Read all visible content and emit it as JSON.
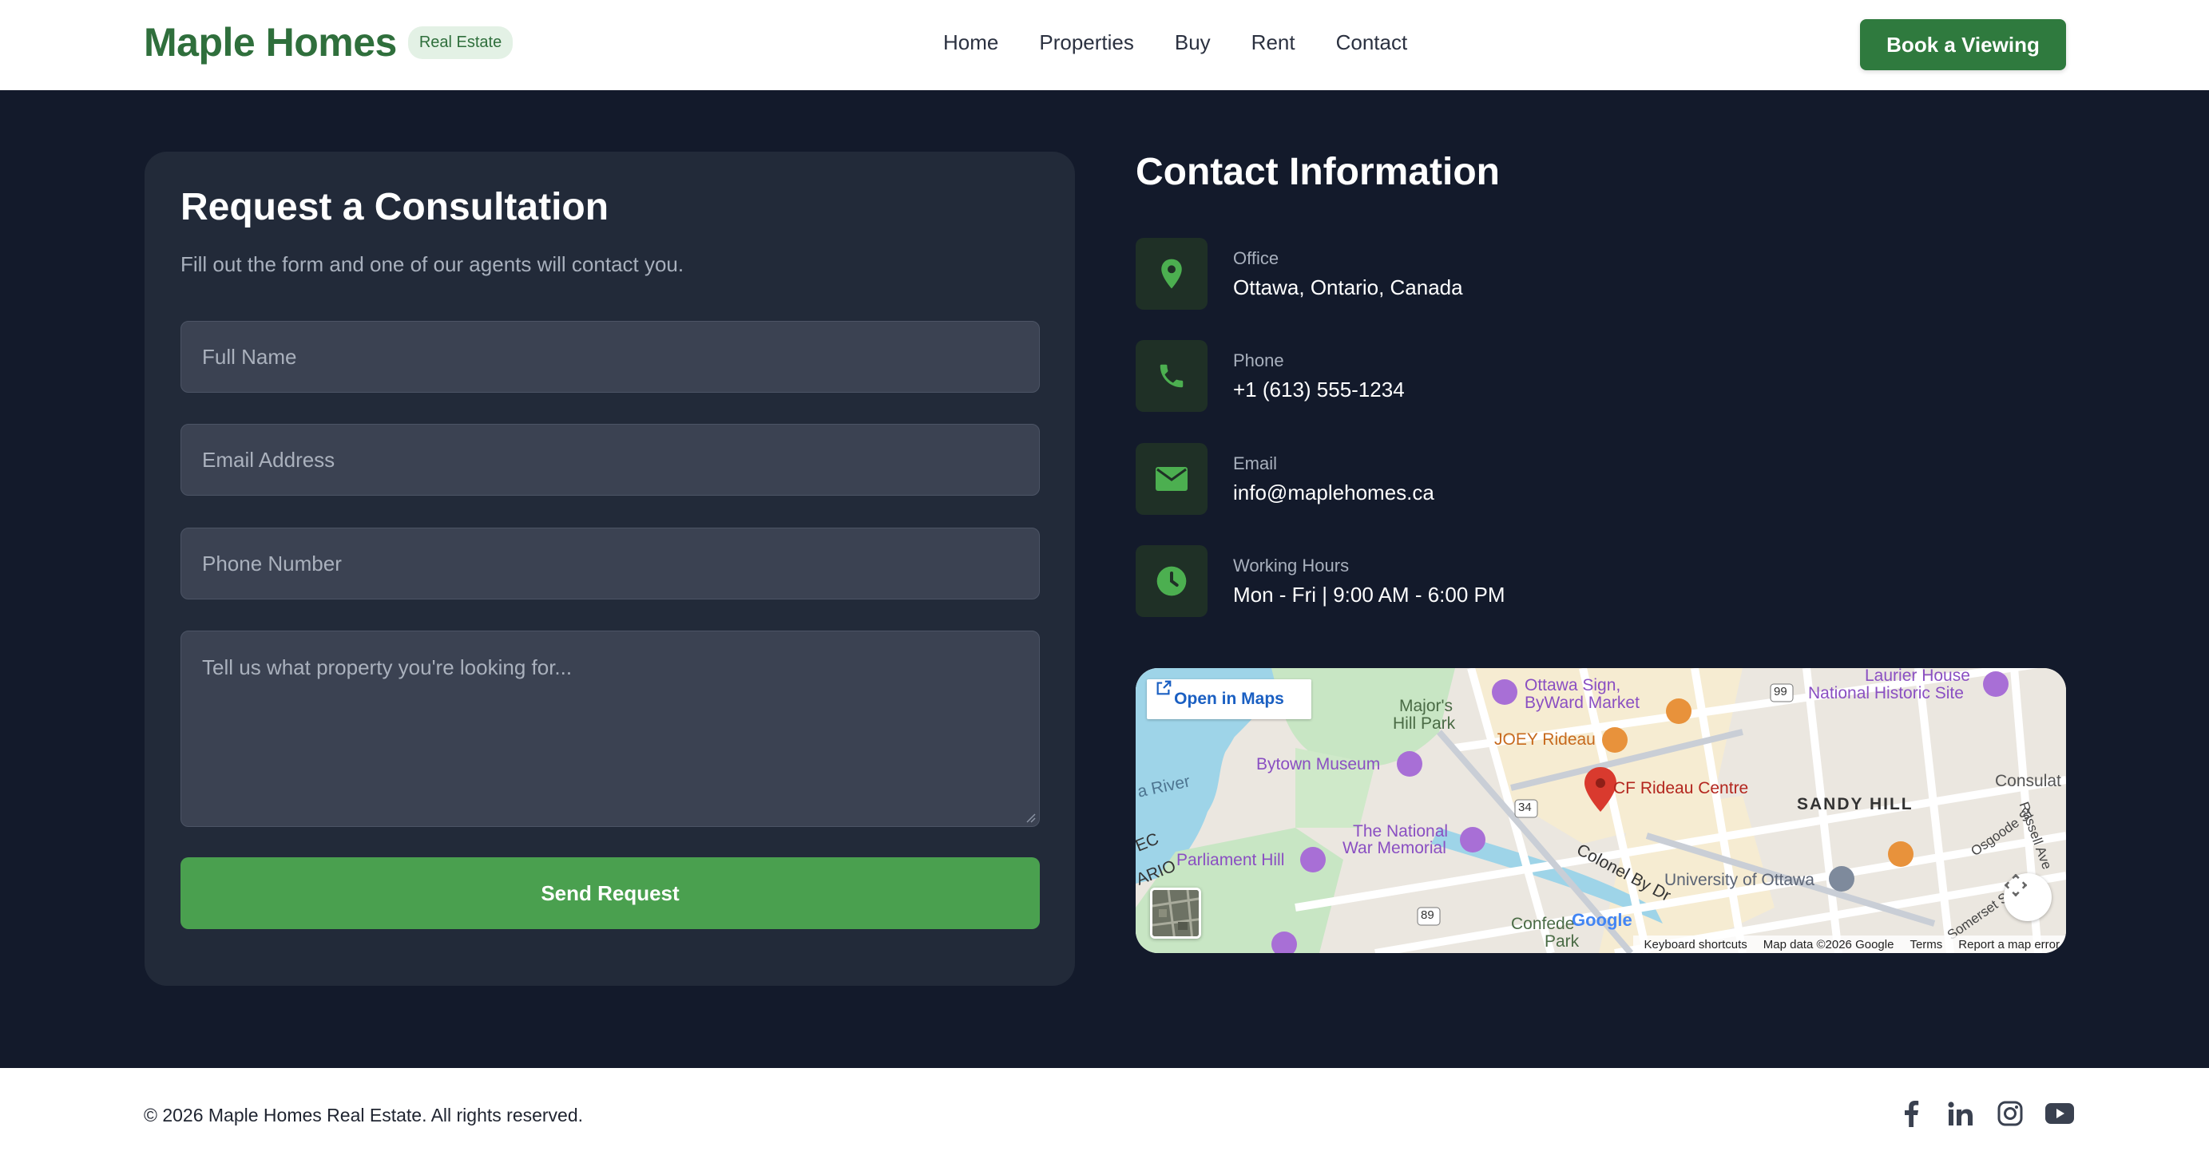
{
  "header": {
    "brand_name": "Maple Homes",
    "brand_badge": "Real Estate",
    "nav": [
      "Home",
      "Properties",
      "Buy",
      "Rent",
      "Contact"
    ],
    "cta_label": "Book a Viewing"
  },
  "form": {
    "title": "Request a Consultation",
    "subtitle": "Fill out the form and one of our agents will contact you.",
    "full_name_placeholder": "Full Name",
    "email_placeholder": "Email Address",
    "phone_placeholder": "Phone Number",
    "message_placeholder": "Tell us what property you're looking for...",
    "submit_label": "Send Request"
  },
  "contact": {
    "title": "Contact Information",
    "items": [
      {
        "label": "Office",
        "value": "Ottawa, Ontario, Canada",
        "icon": "location-pin-icon"
      },
      {
        "label": "Phone",
        "value": "+1 (613) 555-1234",
        "icon": "phone-icon"
      },
      {
        "label": "Email",
        "value": "info@maplehomes.ca",
        "icon": "envelope-icon"
      },
      {
        "label": "Working Hours",
        "value": "Mon - Fri | 9:00 AM - 6:00 PM",
        "icon": "clock-icon"
      }
    ]
  },
  "map": {
    "open_in_maps": "Open in Maps",
    "labels": {
      "cf_rideau": "CF Rideau Centre",
      "sandy_hill": "SANDY HILL",
      "ottawa_sign_1": "Ottawa Sign,",
      "ottawa_sign_2": "ByWard Market",
      "majors_hill_1": "Major's",
      "majors_hill_2": "Hill Park",
      "joey_rideau": "JOEY Rideau",
      "bytown_museum": "Bytown Museum",
      "laurier_1": "Laurier House",
      "laurier_2": "National Historic Site",
      "national_war_1": "The National",
      "national_war_2": "War Memorial",
      "parliament_hill": "Parliament Hill",
      "university": "University of Ottawa",
      "colonel_by": "Colonel By Dr",
      "confederation_1": "Confede",
      "confederation_2": "Park",
      "river": "a River",
      "ec": "EC",
      "ario": "ARIO",
      "consulat": "Consulat",
      "osgoode": "Osgoode St",
      "russell": "Russell Ave",
      "somerset": "Somerset St",
      "road_99": "99",
      "road_34": "34",
      "road_89": "89",
      "google": "Google"
    },
    "footer": [
      "Keyboard shortcuts",
      "Map data ©2026 Google",
      "Terms",
      "Report a map error"
    ]
  },
  "footer": {
    "copyright": "© 2026 Maple Homes Real Estate. All rights reserved.",
    "socials": [
      "facebook-icon",
      "linkedin-icon",
      "instagram-icon",
      "youtube-icon"
    ]
  },
  "colors": {
    "brand_green": "#2f6f3c",
    "button_green": "#4aa04f",
    "page_background": "#131a2b",
    "card_background": "#222a39",
    "icon_green": "#4caf50"
  }
}
